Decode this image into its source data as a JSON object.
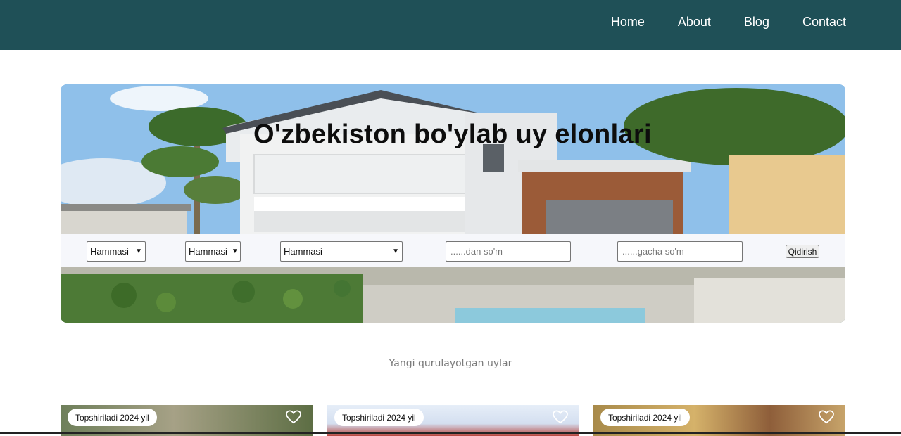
{
  "nav": {
    "links": [
      "Home",
      "About",
      "Blog",
      "Contact"
    ],
    "background": "#1f5057"
  },
  "hero": {
    "title": "O'zbekiston bo'ylab uy elonlari"
  },
  "search": {
    "select1": "Hammasi",
    "select2": "Hammasi",
    "select3": "Hammasi",
    "min_price_placeholder": "......dan so'm",
    "max_price_placeholder": "......gacha so'm",
    "submit_label": "Qidirish"
  },
  "section": {
    "title": "Yangi qurulayotgan uylar"
  },
  "cards": [
    {
      "badge": "Topshiriladi 2024 yil",
      "icon": "heart-icon"
    },
    {
      "badge": "Topshiriladi 2024 yil",
      "icon": "heart-icon"
    },
    {
      "badge": "Topshiriladi 2024 yil",
      "icon": "heart-icon"
    }
  ]
}
